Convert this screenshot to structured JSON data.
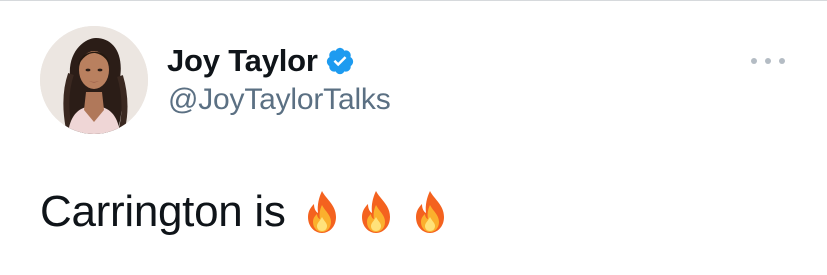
{
  "tweet": {
    "author": {
      "display_name": "Joy Taylor",
      "handle": "@JoyTaylorTalks",
      "verified": true,
      "avatar_icon": "profile-photo"
    },
    "text": "Carrington is",
    "emoji": [
      "🔥",
      "🔥",
      "🔥"
    ],
    "more_icon": "ellipsis-icon"
  },
  "colors": {
    "text": "#0f1419",
    "secondary": "#5b7083",
    "verified_blue": "#1d9bf0",
    "more_dots": "#b4bcc4"
  }
}
